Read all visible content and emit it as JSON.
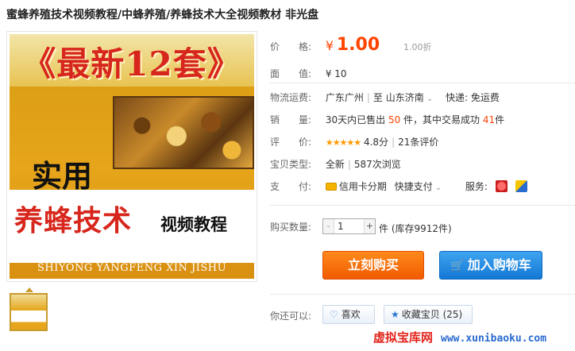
{
  "title": "蜜蜂养殖技术视频教程/中蜂养殖/养蜂技术大全视频教材 非光盘",
  "cover": {
    "headline": "《最新12套》",
    "shiyong": "实用",
    "main_title": "养蜂技术",
    "sub_title": "视频教程",
    "pinyin": "SHIYONG YANGFENG XIN JISHU"
  },
  "price": {
    "label": "价　　格:",
    "currency": "¥",
    "value": "1.00",
    "original": "1.00折"
  },
  "face_value": {
    "label": "面　　值:",
    "value": "¥ 10"
  },
  "shipping": {
    "label": "物流运费:",
    "from": "广东广州",
    "to_word": "至",
    "to": "山东济南",
    "fee": "快递: 免运费"
  },
  "sales": {
    "label": "销　　量:",
    "prefix": "30天内已售出",
    "sold": "50",
    "mid": "件，其中交易成功",
    "success": "41",
    "suffix": "件"
  },
  "rating": {
    "label": "评　　价:",
    "stars": "★★★★★",
    "score": "4.8分",
    "reviews": "21条评价"
  },
  "item_type": {
    "label": "宝贝类型:",
    "condition": "全新",
    "views": "587次浏览"
  },
  "payment": {
    "label": "支　　付:",
    "credit": "信用卡分期",
    "quick": "快捷支付",
    "service_label": "服务:"
  },
  "quantity": {
    "label": "购买数量:",
    "minus": "-",
    "value": "1",
    "plus": "+",
    "stock": "件 (库存9912件)"
  },
  "buttons": {
    "buy_now": "立刻购买",
    "add_cart": "加入购物车",
    "cart_glyph": "🛒"
  },
  "social": {
    "label": "你还可以:",
    "like": "喜欢",
    "favorite": "收藏宝贝 (25)"
  },
  "watermark": {
    "text": "虚拟宝库网",
    "url": "www.xunibaoku.com"
  },
  "colors": {
    "price": "#ff4400",
    "buy_button": "#f05b00",
    "cart_button": "#1478d6"
  }
}
